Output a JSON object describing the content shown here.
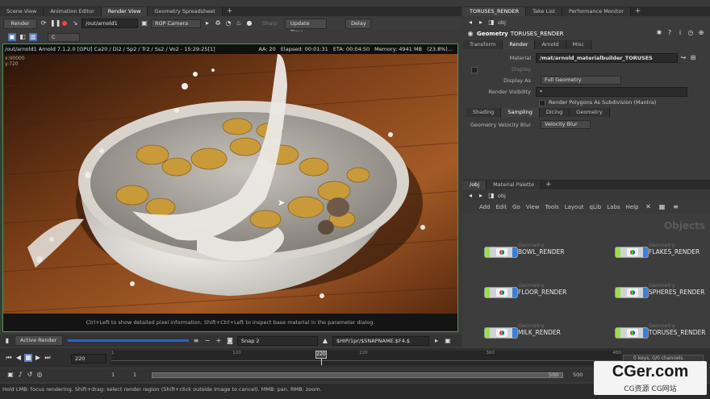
{
  "left_tabs": [
    "Scene View",
    "Animation Editor",
    "Render View",
    "Geometry Spreadsheet"
  ],
  "right_tabs": [
    "TORUSES_RENDER",
    "Take List",
    "Performance Monitor"
  ],
  "render_toolbar": {
    "render": "Render",
    "rop_path": "/out/arnold1",
    "camera": "ROP Camera",
    "sharp": "Sharp",
    "update": "Update Time",
    "delay": "Delay",
    "channel": "C"
  },
  "render_view": {
    "info_left": "/out/arnold1  Arnold 7.1.2.0 [GPU] Ca20 / Di2 / Sp2 / Tr2 / Ss2 / Vo2 - 15:29:25[1]",
    "aa": "AA: 20",
    "elapsed": "Elapsed: 00:01:31",
    "eta": "ETA: 00:04:50",
    "memory": "Memory: 4941 MB",
    "pct": "(23.8%)...",
    "overlay_a": "x:00000",
    "overlay_b": "y:720",
    "hint": "Ctrl+Left to show detailed pixel information. Shift+Ctrl+Left to inspect base material in the parameter dialog."
  },
  "render_bottom": {
    "active_render": "Active Render",
    "snap": "Snap 2",
    "path": "$HIP/1pr/$SNAPNAME.$F4.$"
  },
  "timeline": {
    "frame": "220",
    "ticks": [
      "1",
      "",
      "120",
      "",
      "220",
      "",
      "360",
      "",
      "480"
    ],
    "marker": "220",
    "start": "1",
    "start2": "1",
    "end": "500",
    "end2": "500",
    "keys": "0 keys, 0/0 channels"
  },
  "status_bar": "Hold LMB: focus rendering. Shift+drag: select render region (Shift+click outside image to cancel). MMB: pan. RMB: zoom.",
  "params": {
    "path": "obj",
    "type_label": "Geometry",
    "node_name": "TORUSES_RENDER",
    "top_tabs": [
      "Transform",
      "Render",
      "Arnold",
      "Misc"
    ],
    "material_label": "Material",
    "material_value": "/mat/arnold_materialbuilder_TORUSES",
    "display_label": "Display",
    "display_as_label": "Display As",
    "display_as_value": "Full Geometry",
    "render_vis_label": "Render Visibility",
    "render_vis_value": "*",
    "subdiv_label": "Render Polygons As Subdivision (Mantra)",
    "sub_tabs": [
      "Shading",
      "Sampling",
      "Dicing",
      "Geometry"
    ],
    "velocity_label": "Geometry Velocity Blur",
    "velocity_value": "Velocity Blur"
  },
  "network": {
    "tabs": [
      "/obj",
      "Material Palette"
    ],
    "path": "obj",
    "menu": [
      "Add",
      "Edit",
      "Go",
      "View",
      "Tools",
      "Layout",
      "qLib",
      "Labs",
      "Help"
    ],
    "watermark": "Objects",
    "nodes": [
      {
        "type": "Geometry",
        "name": "BOWL_RENDER"
      },
      {
        "type": "Geometry",
        "name": "FLAKES_RENDER"
      },
      {
        "type": "Geometry",
        "name": "FLOOR_RENDER"
      },
      {
        "type": "Geometry",
        "name": "SPHERES_RENDER"
      },
      {
        "type": "Geometry",
        "name": "MILK_RENDER"
      },
      {
        "type": "Geometry",
        "name": "TORUSES_RENDER"
      }
    ]
  },
  "logo": {
    "main": "CGer.com",
    "sub": "CG资源 CG网站"
  }
}
